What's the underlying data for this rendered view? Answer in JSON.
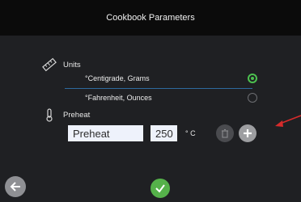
{
  "header": {
    "title": "Cookbook Parameters"
  },
  "units": {
    "label": "Units",
    "icon": "ruler-icon",
    "options": [
      {
        "label": "°Centigrade, Grams",
        "selected": true
      },
      {
        "label": "°Fahrenheit, Ounces",
        "selected": false
      }
    ]
  },
  "preheat": {
    "label": "Preheat",
    "icon": "thermometer-icon",
    "name_value": "Preheat",
    "temp_value": "250",
    "temp_unit": "° C"
  },
  "colors": {
    "accent": "#4cc04f",
    "divider": "#2e6a9e",
    "annotation": "#d62b2b"
  }
}
